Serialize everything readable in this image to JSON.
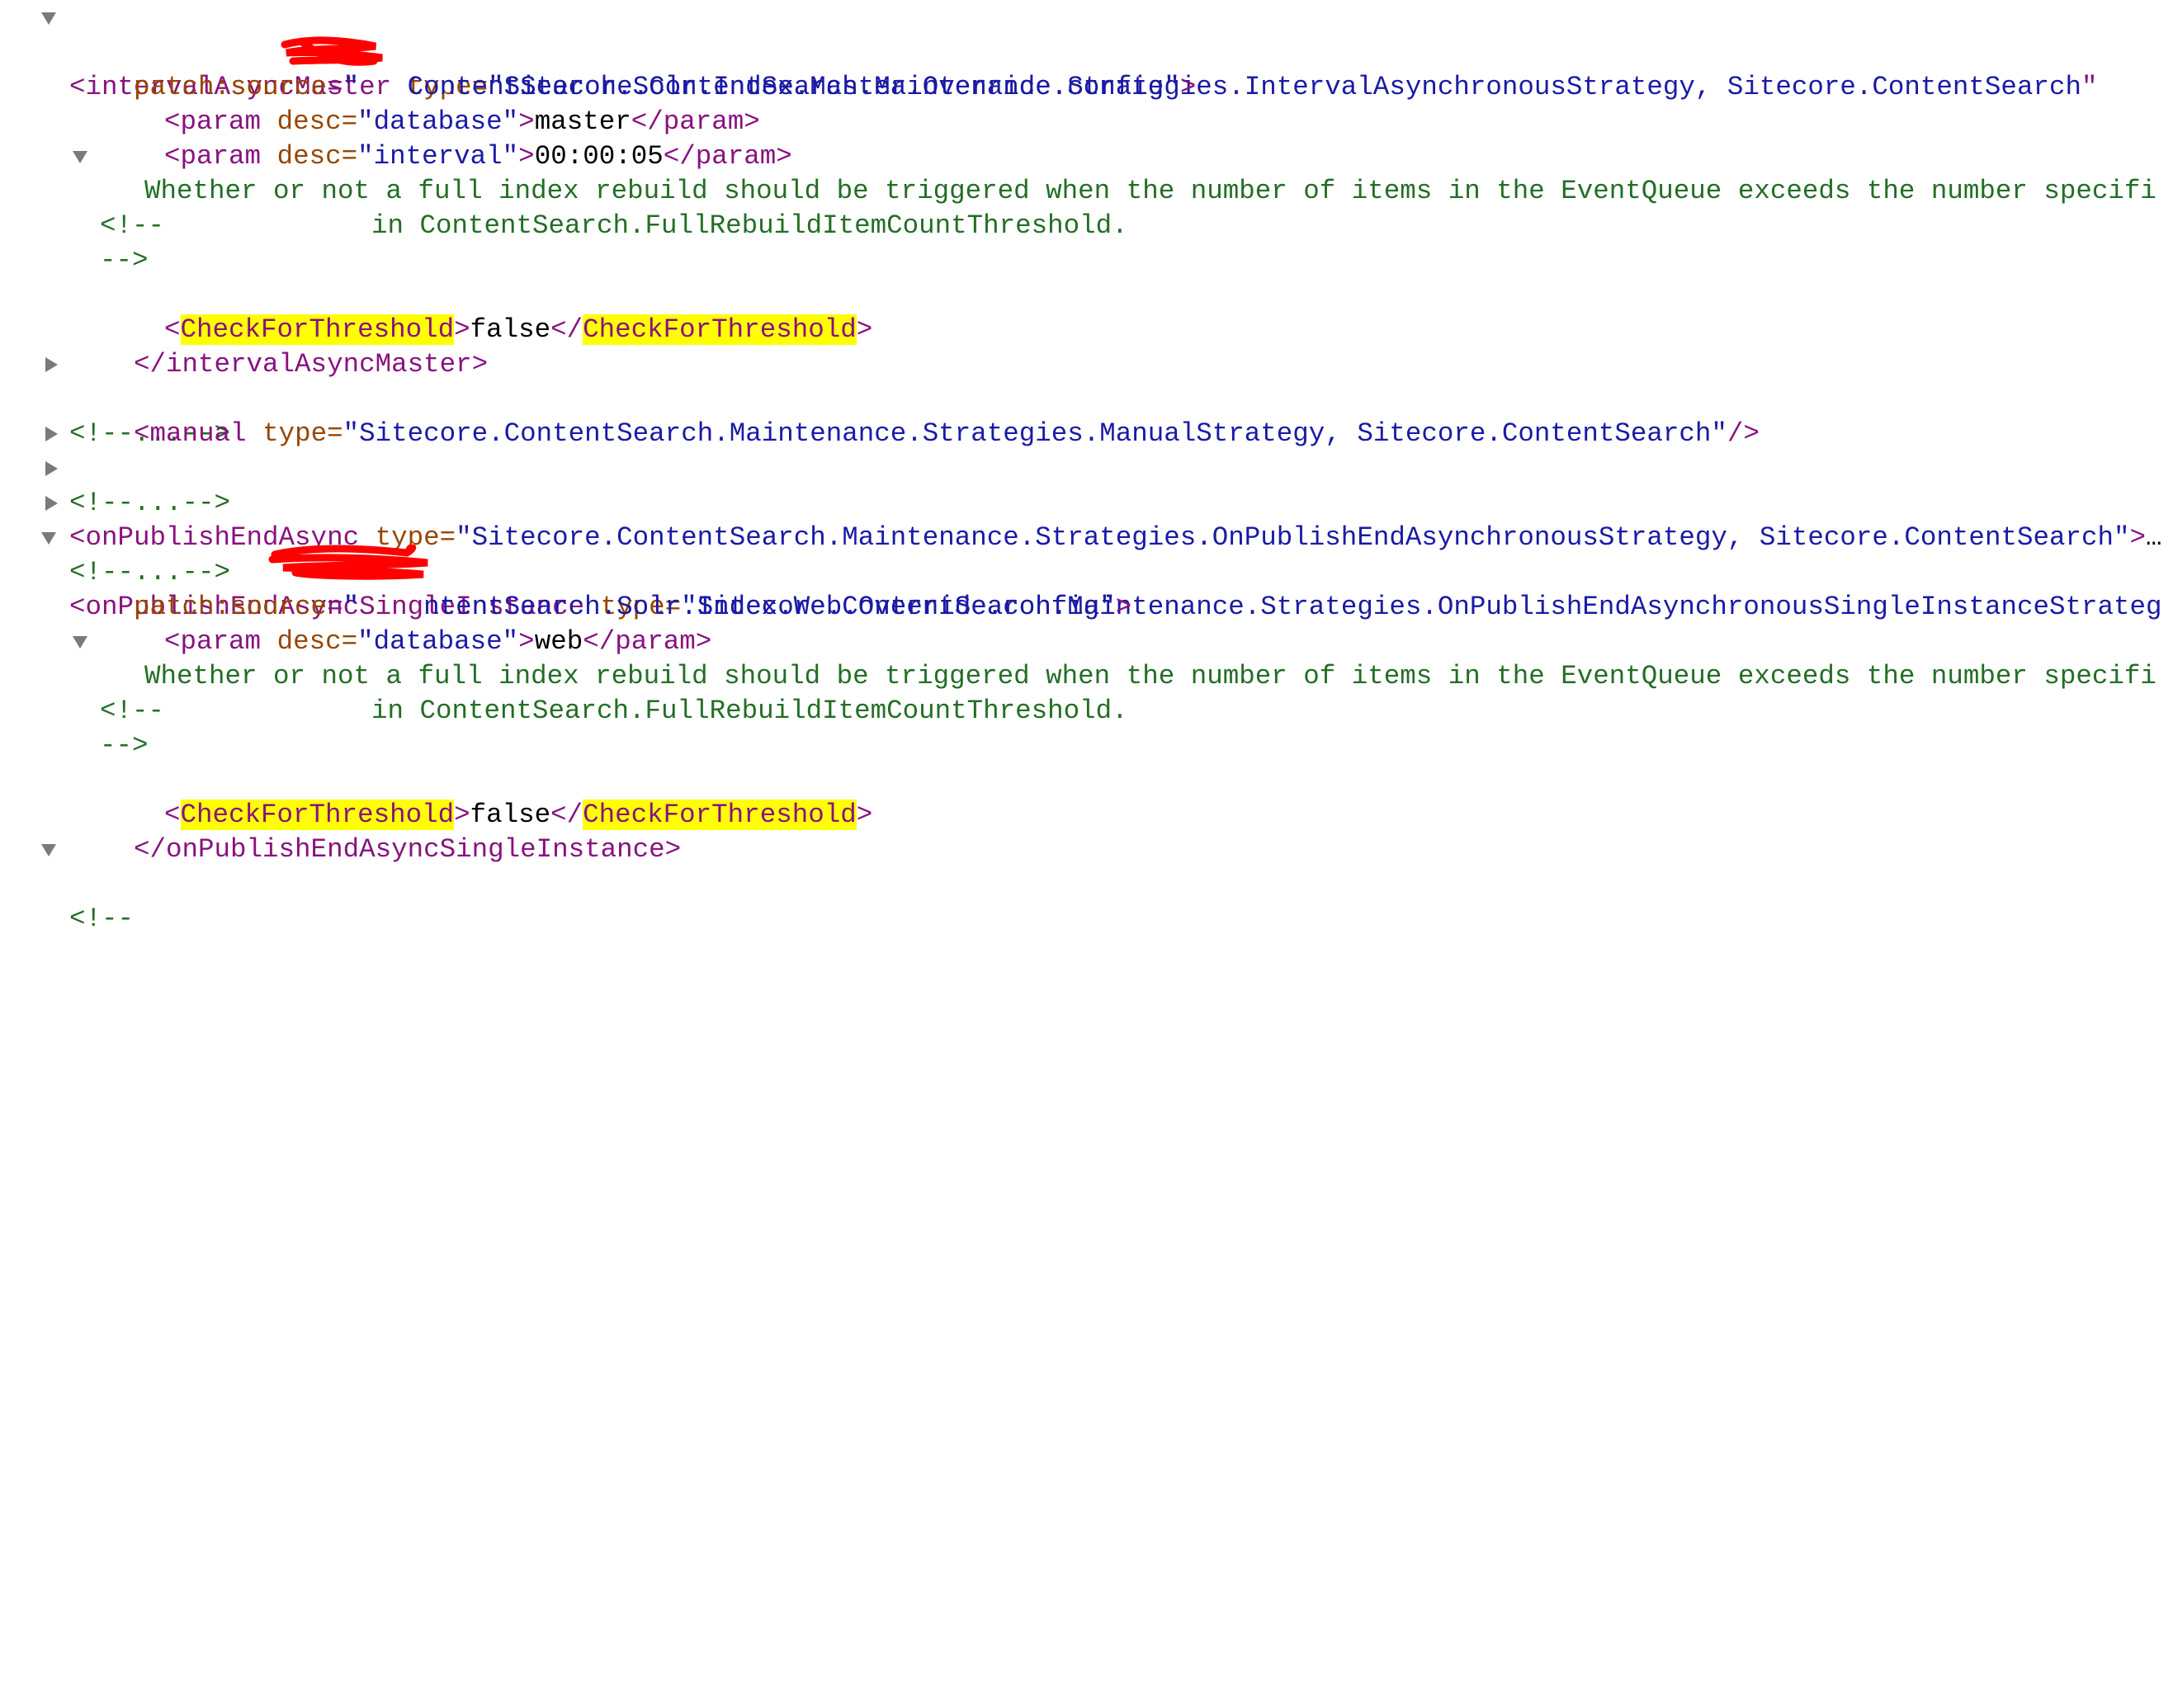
{
  "viewer": {
    "interval_async_master": {
      "tag": "intervalAsyncMaster",
      "type_attr": "type",
      "type_value": "Sitecore.ContentSearch.Maintenance.Strategies.IntervalAsynchronousStrategy, Sitecore.ContentSearch",
      "patch_attr": "patch:source",
      "patch_value_visible": "ContentSearch.Solr.Index.Master.Override.config",
      "params": [
        {
          "tag": "param",
          "attr": "desc",
          "attr_value": "database",
          "text": "master"
        },
        {
          "tag": "param",
          "attr": "desc",
          "attr_value": "interval",
          "text": "00:00:05"
        }
      ],
      "comment_open": "<!--",
      "comment_line1": "Whether or not a full index rebuild should be triggered when the number of items in the EventQueue exceeds the number specifi",
      "comment_line2": "in ContentSearch.FullRebuildItemCountThreshold.",
      "comment_close": "-->",
      "check_tag": "CheckForThreshold",
      "check_value": "false"
    },
    "collapsed_comment": "<!--...-->",
    "manual": {
      "tag": "manual",
      "type_attr": "type",
      "type_value": "Sitecore.ContentSearch.Maintenance.Strategies.ManualStrategy, Sitecore.ContentSearch"
    },
    "on_publish_end_async": {
      "tag": "onPublishEndAsync",
      "type_attr": "type",
      "type_value": "Sitecore.ContentSearch.Maintenance.Strategies.OnPublishEndAsynchronousStrategy, Sitecore.ContentSearch",
      "ellipsis": "…"
    },
    "on_publish_end_async_single": {
      "tag": "onPublishEndAsyncSingleInstance",
      "type_attr": "type",
      "type_value": "Sitecore.ContentSearch.Maintenance.Strategies.OnPublishEndAsynchronousSingleInstanceStrateg",
      "patch_attr": "patch:source",
      "patch_value_visible": "ntentSearch.Solr.Index.Web.Override.config",
      "params": [
        {
          "tag": "param",
          "attr": "desc",
          "attr_value": "database",
          "text": "web"
        }
      ],
      "comment_open": "<!--",
      "comment_line1": "Whether or not a full index rebuild should be triggered when the number of items in the EventQueue exceeds the number specifi",
      "comment_line2": "in ContentSearch.FullRebuildItemCountThreshold.",
      "comment_close": "-->",
      "check_tag": "CheckForThreshold",
      "check_value": "false"
    },
    "trailing_comment_open": "<!--",
    "colors": {
      "tag": "#881280",
      "attr_name": "#994500",
      "attr_value": "#1a1aa6",
      "comment": "#236e25",
      "highlight": "#ffff00",
      "redaction": "#ff0000"
    }
  }
}
